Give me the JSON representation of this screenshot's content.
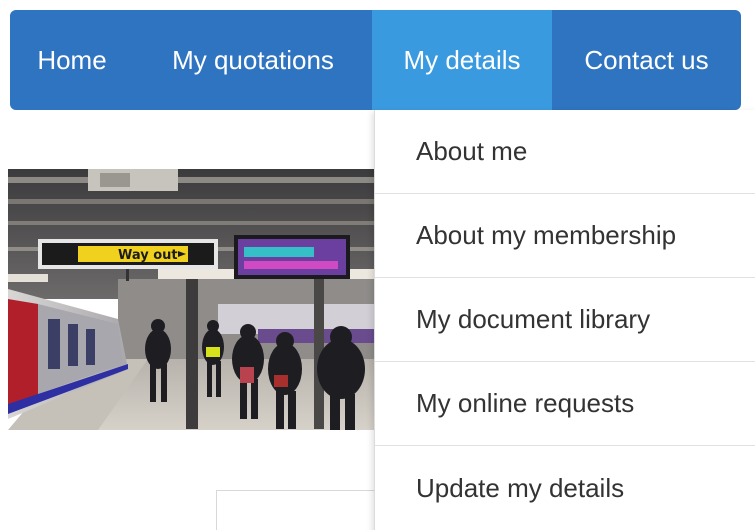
{
  "nav": {
    "items": [
      {
        "label": "Home"
      },
      {
        "label": "My quotations"
      },
      {
        "label": "My details"
      },
      {
        "label": "Contact us"
      }
    ],
    "active_index": 2,
    "colors": {
      "bar": "#2f74c0",
      "active": "#3a9ae0",
      "text": "#ffffff"
    }
  },
  "dropdown": {
    "items": [
      {
        "label": "About me"
      },
      {
        "label": "About my membership"
      },
      {
        "label": "My document library"
      },
      {
        "label": "My online requests"
      },
      {
        "label": "Update my details"
      }
    ]
  },
  "hero": {
    "sign_text": "Way out"
  }
}
